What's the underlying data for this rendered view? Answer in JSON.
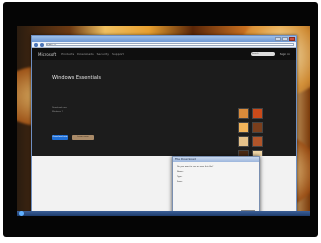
{
  "browser": {
    "address": "http://",
    "window_buttons": [
      "minimize",
      "maximize",
      "close"
    ]
  },
  "site": {
    "logo": "Microsoft",
    "nav": [
      "Products",
      "Downloads",
      "Security",
      "Support"
    ],
    "search_placeholder": "Search",
    "signin": "Sign in"
  },
  "hero": {
    "title": "Windows Essentials",
    "lines": [
      "Download now",
      "Windows 7"
    ],
    "download_label": "Download now",
    "learn_label": "Learn more"
  },
  "thumbnails": [
    {
      "color": "#d98a3a"
    },
    {
      "color": "#c94a1a"
    },
    {
      "color": "#f2b45a"
    },
    {
      "color": "#7a3e1c"
    },
    {
      "color": "#e6c28a"
    },
    {
      "color": "#b0552a"
    },
    {
      "color": "#4a2a14"
    },
    {
      "color": "#f0d6a6"
    }
  ],
  "footer": {
    "col1": [
      "",
      "",
      "",
      "",
      "",
      "",
      ""
    ],
    "col2": [
      "",
      "",
      "",
      "",
      "",
      "",
      ""
    ]
  },
  "dialog": {
    "title": "File Download",
    "lines": [
      "Do you want to run or save this file?",
      "Name:",
      "Type:",
      "From:"
    ],
    "button": "Run"
  },
  "colors": {
    "accent": "#1f6fd6",
    "frame": "#050505",
    "taskbar": "#2a4b80"
  }
}
